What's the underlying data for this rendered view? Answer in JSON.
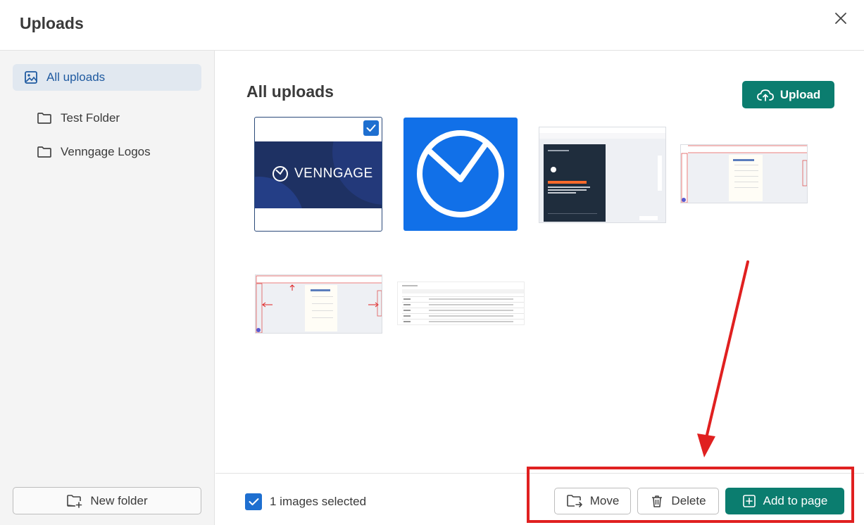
{
  "header": {
    "title": "Uploads"
  },
  "sidebar": {
    "active_item": {
      "label": "All uploads",
      "icon": "image-icon"
    },
    "folders": [
      {
        "label": "Test Folder",
        "icon": "folder-icon"
      },
      {
        "label": "Venngage Logos",
        "icon": "folder-icon"
      }
    ],
    "new_folder_label": "New folder"
  },
  "main": {
    "title": "All uploads",
    "upload_label": "Upload",
    "thumbnails": [
      {
        "kind": "venngage-banner",
        "logo_text": "VENNGAGE",
        "selected": true
      },
      {
        "kind": "clock-logo",
        "selected": false
      },
      {
        "kind": "screenshot-poster",
        "selected": false
      },
      {
        "kind": "screenshot-editor",
        "selected": false
      },
      {
        "kind": "screenshot-editor-annotated",
        "selected": false
      },
      {
        "kind": "table-screenshot",
        "selected": false
      }
    ]
  },
  "footer": {
    "selected_text": "1 images selected",
    "move_label": "Move",
    "delete_label": "Delete",
    "add_label": "Add to page"
  },
  "colors": {
    "primary": "#0b7d6f",
    "accent": "#1e6fd0",
    "annotation": "#e02020",
    "brand_navy": "#1e3163",
    "brand_blue": "#1170e8"
  }
}
